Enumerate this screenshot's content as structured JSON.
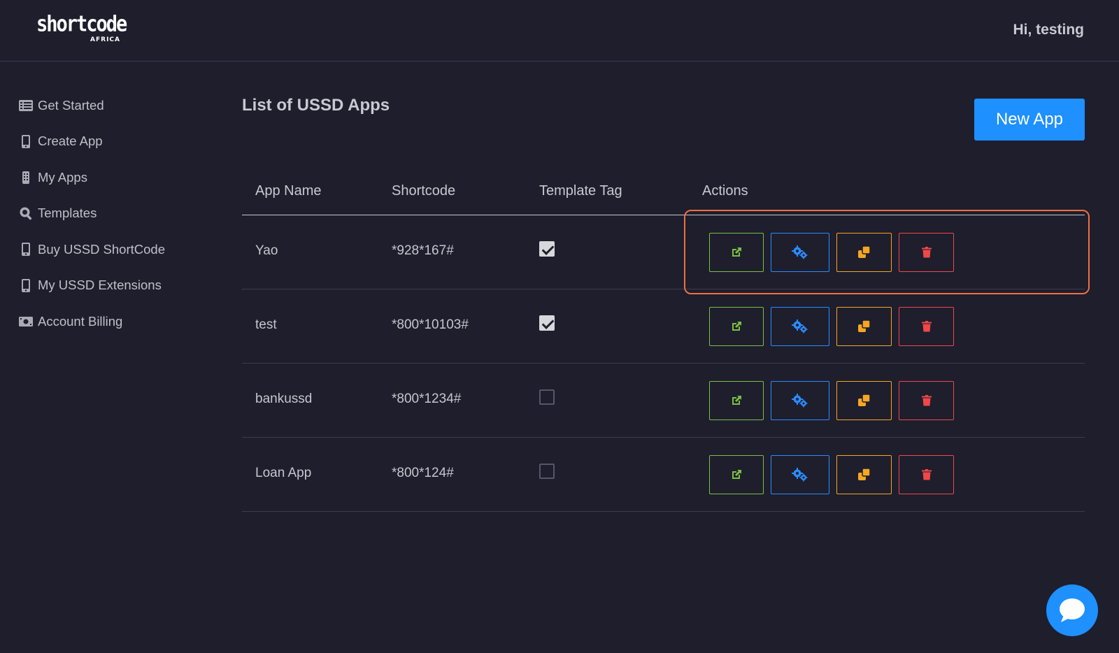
{
  "header": {
    "logo_text": "shortcode",
    "logo_sub": "AFRICA",
    "greeting": "Hi, testing"
  },
  "sidebar": {
    "items": [
      {
        "label": "Get Started",
        "icon": "list-icon"
      },
      {
        "label": "Create App",
        "icon": "mobile-icon"
      },
      {
        "label": "My Apps",
        "icon": "mobile-icon"
      },
      {
        "label": "Templates",
        "icon": "search-icon"
      },
      {
        "label": "Buy USSD ShortCode",
        "icon": "mobile-icon"
      },
      {
        "label": "My USSD Extensions",
        "icon": "mobile-icon"
      },
      {
        "label": "Account Billing",
        "icon": "money-icon"
      }
    ]
  },
  "main": {
    "title": "List of USSD Apps",
    "new_app_label": "New App",
    "columns": [
      "App Name",
      "Shortcode",
      "Template Tag",
      "Actions"
    ],
    "rows": [
      {
        "name": "Yao",
        "shortcode": "*928*167#",
        "template": true
      },
      {
        "name": "test",
        "shortcode": "*800*10103#",
        "template": true
      },
      {
        "name": "bankussd",
        "shortcode": "*800*1234#",
        "template": false
      },
      {
        "name": "Loan App",
        "shortcode": "*800*124#",
        "template": false
      }
    ],
    "action_icons": [
      "external-link-icon",
      "gears-icon",
      "copy-icon",
      "trash-icon"
    ]
  },
  "colors": {
    "background": "#1e1e2d",
    "primary": "#1e90ff",
    "open": "#7bc142",
    "settings": "#2b8cff",
    "copy": "#f5a623",
    "delete": "#f04848",
    "highlight": "#f07040"
  },
  "chat": {
    "icon": "chat-bubble-icon"
  }
}
